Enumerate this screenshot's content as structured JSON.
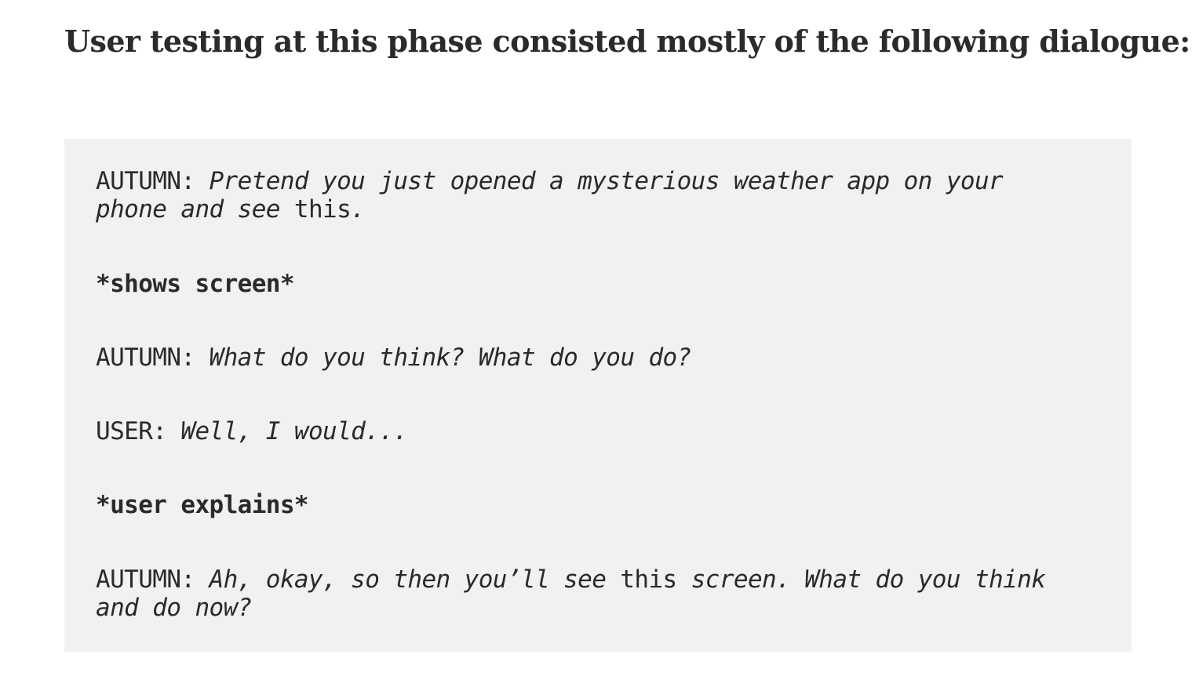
{
  "heading": "User testing at this phase consisted mostly of the following dialogue:",
  "dialogue": {
    "line1": {
      "speaker": "AUTUMN: ",
      "italic_a": "Pretend you just opened a mysterious weather app on your",
      "italic_b": "phone and see",
      "plain": " this",
      "italic_c": "."
    },
    "action1": "*shows screen*",
    "line2": {
      "speaker": "AUTUMN: ",
      "italic": "What do you think? What do you do?"
    },
    "line3": {
      "speaker": "USER: ",
      "italic": "Well, I would..."
    },
    "action2": "*user explains*",
    "line4": {
      "speaker": "AUTUMN: ",
      "italic_a": "Ah, okay, so then you’ll see",
      "plain": " this",
      "italic_b": " screen. What do you think",
      "italic_c": "and do now?"
    }
  }
}
